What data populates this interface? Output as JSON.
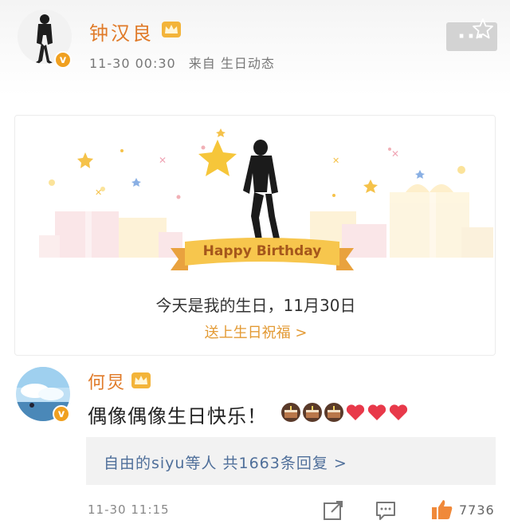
{
  "post": {
    "author": "钟汉良",
    "time": "11-30 00:30",
    "source": "来自 生日动态",
    "verified": "v",
    "more_label": "···"
  },
  "birthday_card": {
    "ribbon_text": "Happy Birthday",
    "message": "今天是我的生日，11月30日",
    "action_label": "送上生日祝福 >"
  },
  "comment": {
    "author": "何炅",
    "verified": "v",
    "text": "偶像偶像生日快乐！",
    "emojis": [
      "cake-icon",
      "cake-icon",
      "cake-icon",
      "heart-icon",
      "heart-icon",
      "heart-icon"
    ],
    "reply_summary": "自由的siyu等人  共1663条回复  >",
    "time": "11-30 11:15",
    "like_count": "7736"
  },
  "colors": {
    "name_orange": "#e07a28",
    "link_blue": "#4f6f9a",
    "gold": "#e39a34",
    "badge": "#f0a020"
  }
}
